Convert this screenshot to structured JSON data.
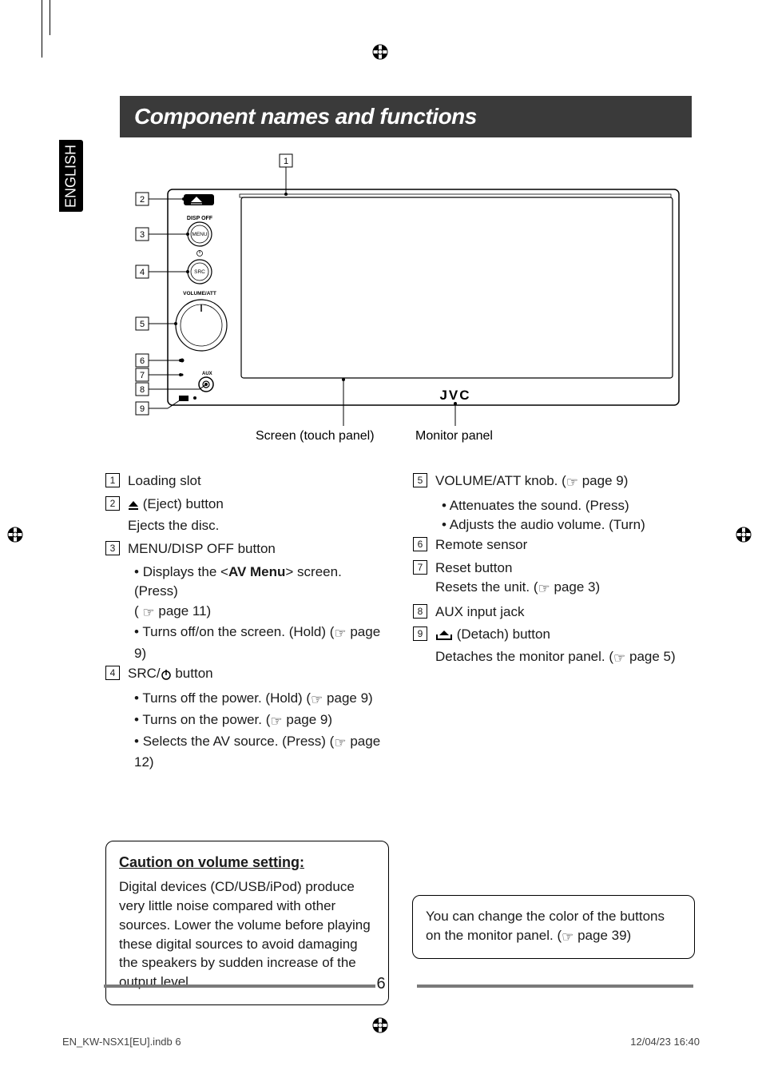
{
  "heading": "Component names and functions",
  "language_tab": "ENGLISH",
  "diagram": {
    "callouts": [
      "1",
      "2",
      "3",
      "4",
      "5",
      "6",
      "7",
      "8",
      "9"
    ],
    "labels": {
      "screen": "Screen (touch panel)",
      "monitor_panel": "Monitor panel",
      "disp_off": "DISP OFF",
      "menu": "MENU",
      "src": "SRC",
      "volume_att": "VOLUME/ATT",
      "aux": "AUX",
      "brand": "JVC"
    }
  },
  "left_col": {
    "i1": {
      "title": "Loading slot"
    },
    "i2": {
      "title_pre": "",
      "title_post": " (Eject) button",
      "desc": "Ejects the disc."
    },
    "i3": {
      "title": "MENU/DISP OFF button",
      "b1_pre": "Displays the <",
      "b1_bold": "AV Menu",
      "b1_post": "> screen. (Press)",
      "b1_ref": " page 11)",
      "b2": "Turns off/on the screen. (Hold) (",
      "b2_ref": " page 9)"
    },
    "i4": {
      "title_pre": "SRC/",
      "title_post": " button",
      "b1": "Turns off the power. (Hold) (",
      "b1_ref": " page 9)",
      "b2": "Turns on the power. (",
      "b2_ref": " page 9)",
      "b3": "Selects the AV source. (Press) (",
      "b3_ref": " page 12)"
    }
  },
  "right_col": {
    "i5": {
      "title": "VOLUME/ATT knob. (",
      "title_ref": " page 9)",
      "b1": "Attenuates the sound. (Press)",
      "b2": "Adjusts the audio volume. (Turn)"
    },
    "i6": {
      "title": "Remote sensor"
    },
    "i7": {
      "title": "Reset button",
      "desc_pre": "Resets the unit. (",
      "desc_ref": " page 3)"
    },
    "i8": {
      "title": "AUX input jack"
    },
    "i9": {
      "title_post": " (Detach) button",
      "desc_pre": "Detaches the monitor panel. (",
      "desc_ref": " page 5)"
    }
  },
  "caution": {
    "heading": "Caution on volume setting:",
    "body": "Digital devices (CD/USB/iPod) produce very little noise compared with other sources. Lower the volume before playing these digital sources to avoid damaging the speakers by sudden increase of the output level."
  },
  "colorbox": {
    "body_pre": "You can change the color of the buttons on the monitor panel. (",
    "body_ref": " page 39)"
  },
  "page_number": "6",
  "imprint_left": "EN_KW-NSX1[EU].indb   6",
  "imprint_right": "12/04/23   16:40"
}
